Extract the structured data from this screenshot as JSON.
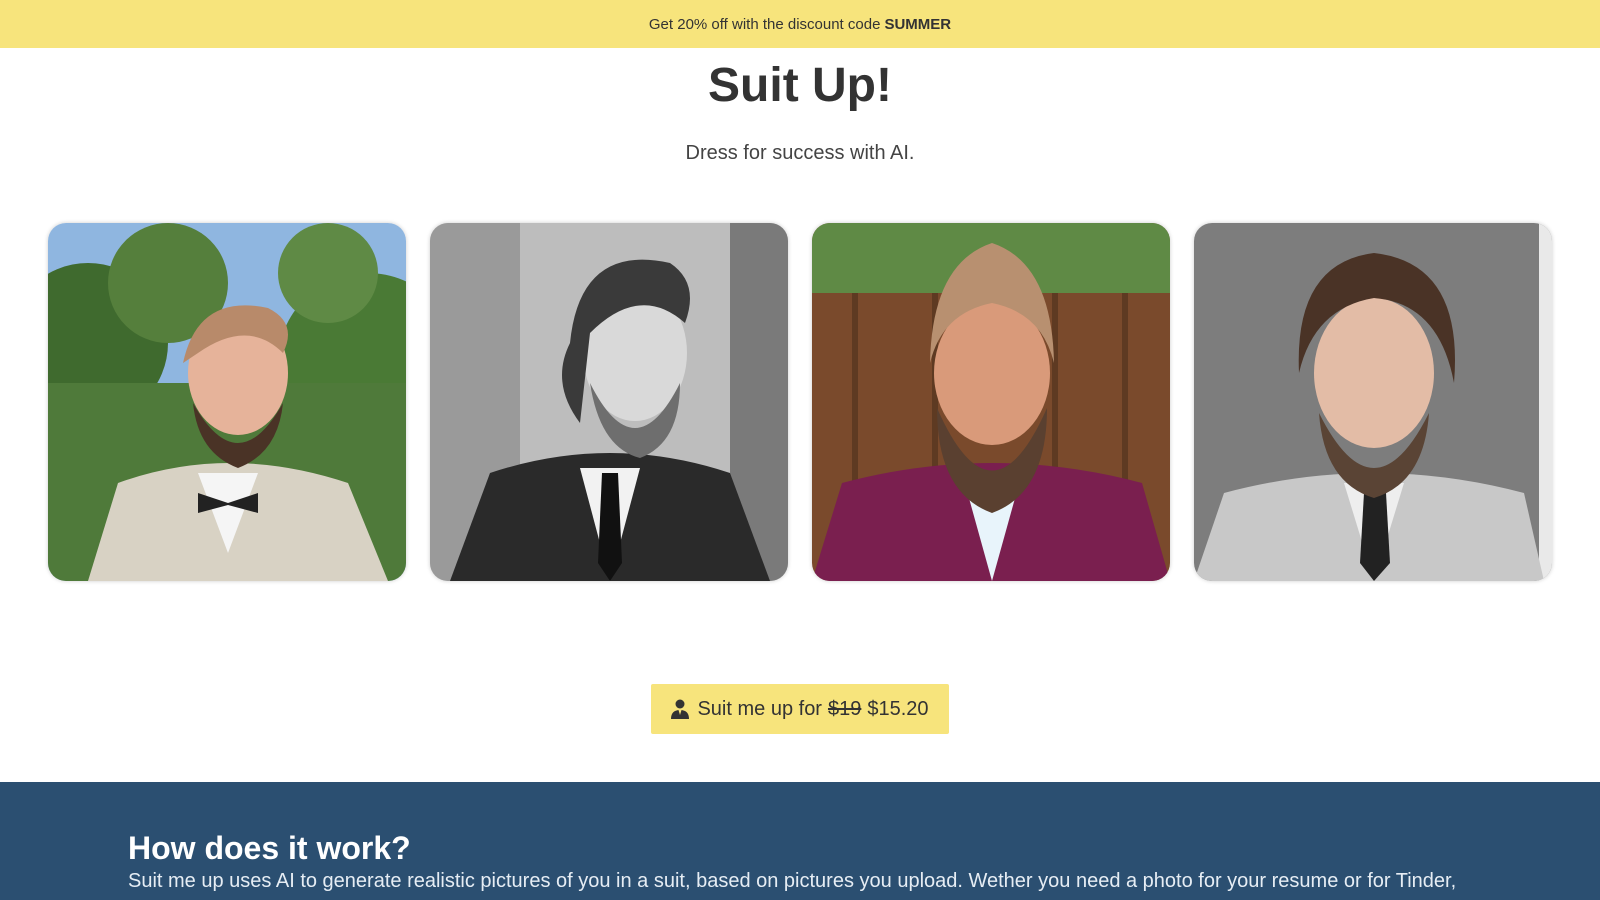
{
  "promo": {
    "text": "Get 20% off with the discount code",
    "code": "SUMMER"
  },
  "hero": {
    "title": "Suit Up!",
    "subtitle": "Dress for success with AI."
  },
  "gallery": {
    "photos": [
      {
        "icon": "man-in-beige-suit-photo"
      },
      {
        "icon": "man-in-dark-suit-bw-photo"
      },
      {
        "icon": "man-in-purple-suit-photo"
      },
      {
        "icon": "man-in-grey-suit-photo"
      }
    ]
  },
  "cta": {
    "label_prefix": "Suit me up for",
    "old_price": "$19",
    "new_price": "$15.20",
    "icon": "person-suit-icon"
  },
  "how": {
    "title": "How does it work?",
    "text": "Suit me up uses AI to generate realistic pictures of you in a suit, based on pictures you upload. Wether you need a photo for your resume or for Tinder,"
  },
  "colors": {
    "accent_yellow": "#f7e47c",
    "section_blue": "#2b4f71",
    "text_dark": "#333333"
  }
}
